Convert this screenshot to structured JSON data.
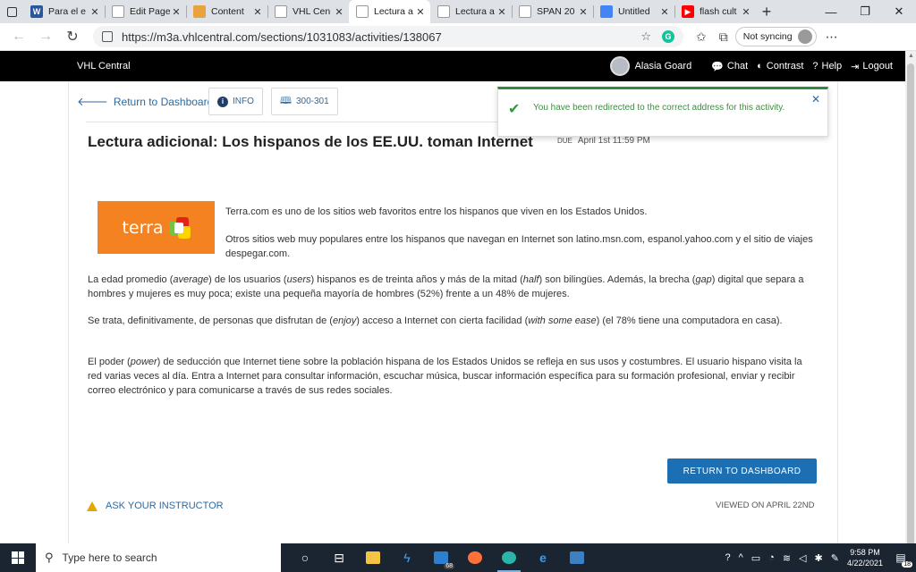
{
  "browser": {
    "tabs": [
      {
        "title": "Para el e",
        "icon": "word-icon",
        "color": "#2b579a",
        "glyph": "W"
      },
      {
        "title": "Edit Page",
        "icon": "page-icon",
        "color": "#ffffff",
        "glyph": ""
      },
      {
        "title": "Content",
        "icon": "content-icon",
        "color": "#e8a33d",
        "glyph": ""
      },
      {
        "title": "VHL Cen",
        "icon": "vhl-icon",
        "color": "#ffffff",
        "glyph": ""
      },
      {
        "title": "Lectura a",
        "icon": "vhl-icon",
        "color": "#ffffff",
        "glyph": ""
      },
      {
        "title": "Lectura a",
        "icon": "vhl-icon",
        "color": "#ffffff",
        "glyph": ""
      },
      {
        "title": "SPAN 20",
        "icon": "page-icon",
        "color": "#ffffff",
        "glyph": ""
      },
      {
        "title": "Untitled",
        "icon": "docs-icon",
        "color": "#4285f4",
        "glyph": ""
      },
      {
        "title": "flash cult",
        "icon": "youtube-icon",
        "color": "#ff0000",
        "glyph": "▶"
      }
    ],
    "active_tab": 4,
    "new_tab": "+",
    "window_controls": {
      "minimize": "—",
      "restore": "❐",
      "close": "✕"
    },
    "url": "https://m3a.vhlcentral.com/sections/1031083/activities/138067",
    "sync_label": "Not syncing",
    "extension_glyph": "G",
    "more_glyph": "⋯"
  },
  "vhl": {
    "brand": "VHL Central",
    "user_name": "Alasia Goard",
    "links": {
      "chat": "Chat",
      "contrast": "Contrast",
      "help": "Help",
      "logout": "Logout"
    }
  },
  "page": {
    "back_label": "Return to Dashboard",
    "info_label": "INFO",
    "pages_label": "300-301",
    "title": "Lectura adicional: Los hispanos de los EE.UU. toman Internet",
    "due_label": "DUE",
    "due_date": "April 1st 11:59 PM",
    "toast": "You have been redirected to the correct address for this activity.",
    "terra_logo_text": "terra",
    "paragraphs": [
      "Terra.com es uno de los sitios web favoritos entre los hispanos que viven en los Estados Unidos.",
      "Otros sitios web muy populares entre los hispanos que navegan en Internet son latino.msn.com, espanol.yahoo.com y el sitio de viajes despegar.com."
    ],
    "p3": {
      "a": "La edad promedio (",
      "average": "average",
      "b": ") de los usuarios (",
      "users": "users",
      "c": ") hispanos es de treinta años y más de la mitad (",
      "half": "half",
      "d": ") son bilingües. Además, la brecha (",
      "gap": "gap",
      "e": ") digital que separa a hombres y mujeres es muy poca; existe una pequeña mayoría de hombres (52%) frente a un 48% de mujeres."
    },
    "p4": {
      "a": "Se trata, definitivamente, de personas que disfrutan de (",
      "enjoy": "enjoy",
      "b": ") acceso a Internet con cierta facilidad (",
      "ease": "with some ease",
      "c": ") (el 78% tiene una computadora en casa)."
    },
    "p5": {
      "a": "El poder (",
      "power": "power",
      "b": ") de seducción que Internet tiene sobre la población hispana de los Estados Unidos se refleja en sus usos y costumbres. El usuario hispano visita la red varias veces al día. Entra a Internet para consultar información, escuchar música, buscar información específica para su formación profesional, enviar y recibir correo electrónico y para comunicarse a través de sus redes sociales."
    },
    "return_button": "RETURN TO DASHBOARD",
    "ask_instructor": "ASK YOUR INSTRUCTOR",
    "viewed": "VIEWED ON APRIL 22ND"
  },
  "taskbar": {
    "search_placeholder": "Type here to search",
    "mail_badge": "68",
    "time": "9:58 PM",
    "date": "4/22/2021",
    "notifications": "18"
  }
}
